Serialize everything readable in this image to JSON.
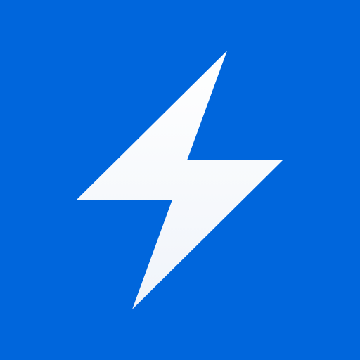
{
  "icon": {
    "name": "lightning-bolt-icon",
    "background_color": "#0066DC",
    "bolt_color_top": "#FFFFFF",
    "bolt_color_bottom": "#F0F4FA"
  }
}
